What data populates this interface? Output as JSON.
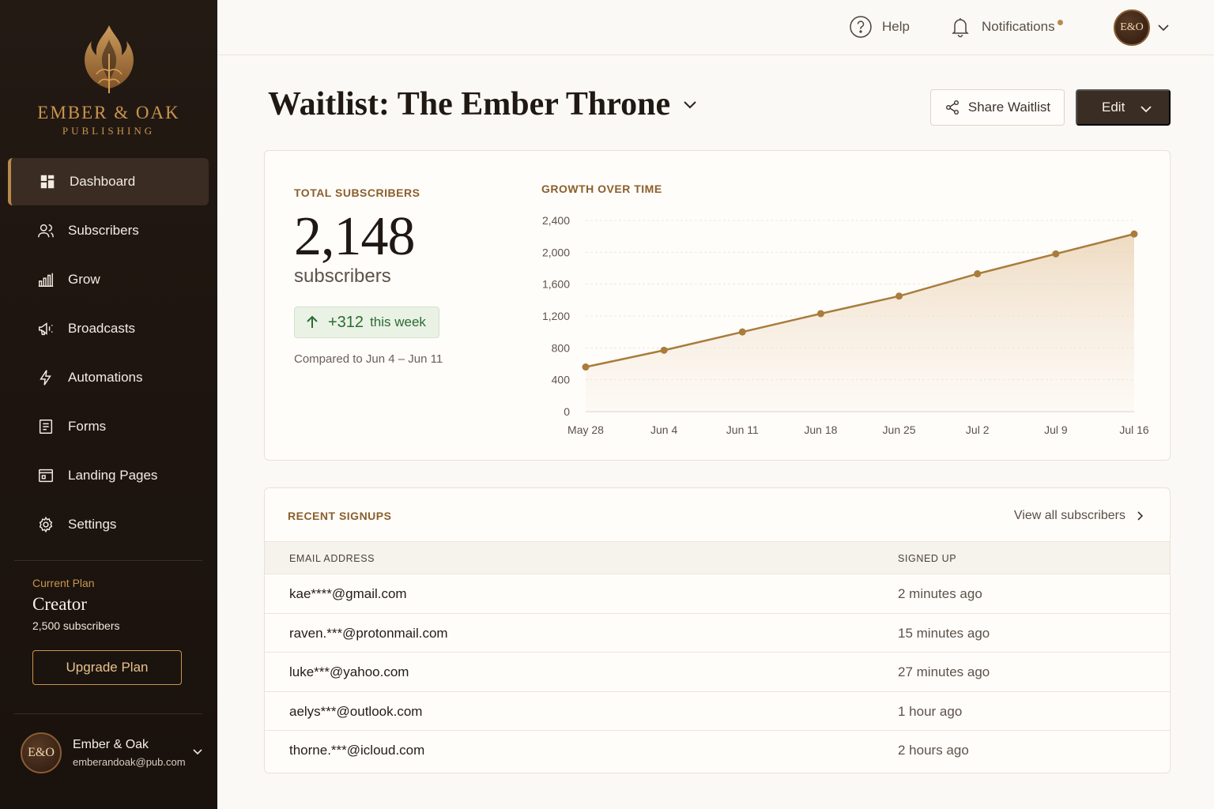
{
  "brand": {
    "name": "EMBER & OAK",
    "sub": "PUBLISHING"
  },
  "sidebar": {
    "items": [
      {
        "label": "Dashboard",
        "icon": "dashboard-icon",
        "active": true
      },
      {
        "label": "Subscribers",
        "icon": "users-icon"
      },
      {
        "label": "Grow",
        "icon": "bar-chart-icon"
      },
      {
        "label": "Broadcasts",
        "icon": "megaphone-icon"
      },
      {
        "label": "Automations",
        "icon": "lightning-icon"
      },
      {
        "label": "Forms",
        "icon": "form-icon"
      },
      {
        "label": "Landing Pages",
        "icon": "landing-page-icon"
      },
      {
        "label": "Settings",
        "icon": "gear-icon"
      }
    ],
    "plan": {
      "label": "Current Plan",
      "name": "Creator",
      "limit": "2,500 subscribers",
      "upgrade_label": "Upgrade Plan"
    },
    "account": {
      "avatar": "E&O",
      "name": "Ember & Oak",
      "email": "emberandoak@pub.com"
    }
  },
  "topbar": {
    "help_label": "Help",
    "notifications_label": "Notifications",
    "avatar": "E&O"
  },
  "page": {
    "title": "Waitlist: The Ember Throne",
    "share_label": "Share Waitlist",
    "edit_label": "Edit"
  },
  "stats": {
    "label": "TOTAL SUBSCRIBERS",
    "value": "2,148",
    "unit": "subscribers",
    "delta_value": "+312",
    "delta_suffix": "this week",
    "compare": "Compared to Jun 4 – Jun 11"
  },
  "chart_data": {
    "type": "area",
    "title": "GROWTH OVER TIME",
    "categories": [
      "May 28",
      "Jun 4",
      "Jun 11",
      "Jun 18",
      "Jun 25",
      "Jul 2",
      "Jul 9",
      "Jul 16"
    ],
    "values": [
      560,
      770,
      1000,
      1230,
      1450,
      1730,
      1980,
      2230
    ],
    "y_ticks": [
      "0",
      "400",
      "800",
      "1,200",
      "1,600",
      "2,000",
      "2,400"
    ],
    "ylim": [
      0,
      2400
    ],
    "grid": true,
    "color": "#a97c3d"
  },
  "signups": {
    "label": "RECENT SIGNUPS",
    "view_all": "View all subscribers",
    "columns": [
      "EMAIL ADDRESS",
      "SIGNED UP"
    ],
    "rows": [
      {
        "email": "kae****@gmail.com",
        "time": "2 minutes ago"
      },
      {
        "email": "raven.***@protonmail.com",
        "time": "15 minutes ago"
      },
      {
        "email": "luke***@yahoo.com",
        "time": "27 minutes ago"
      },
      {
        "email": "aelys***@outlook.com",
        "time": "1 hour ago"
      },
      {
        "email": "thorne.***@icloud.com",
        "time": "2 hours ago"
      }
    ]
  },
  "colors": {
    "accent": "#b98a4b",
    "sidebar_bg": "#1e1510",
    "positive": "#2e6b33"
  }
}
